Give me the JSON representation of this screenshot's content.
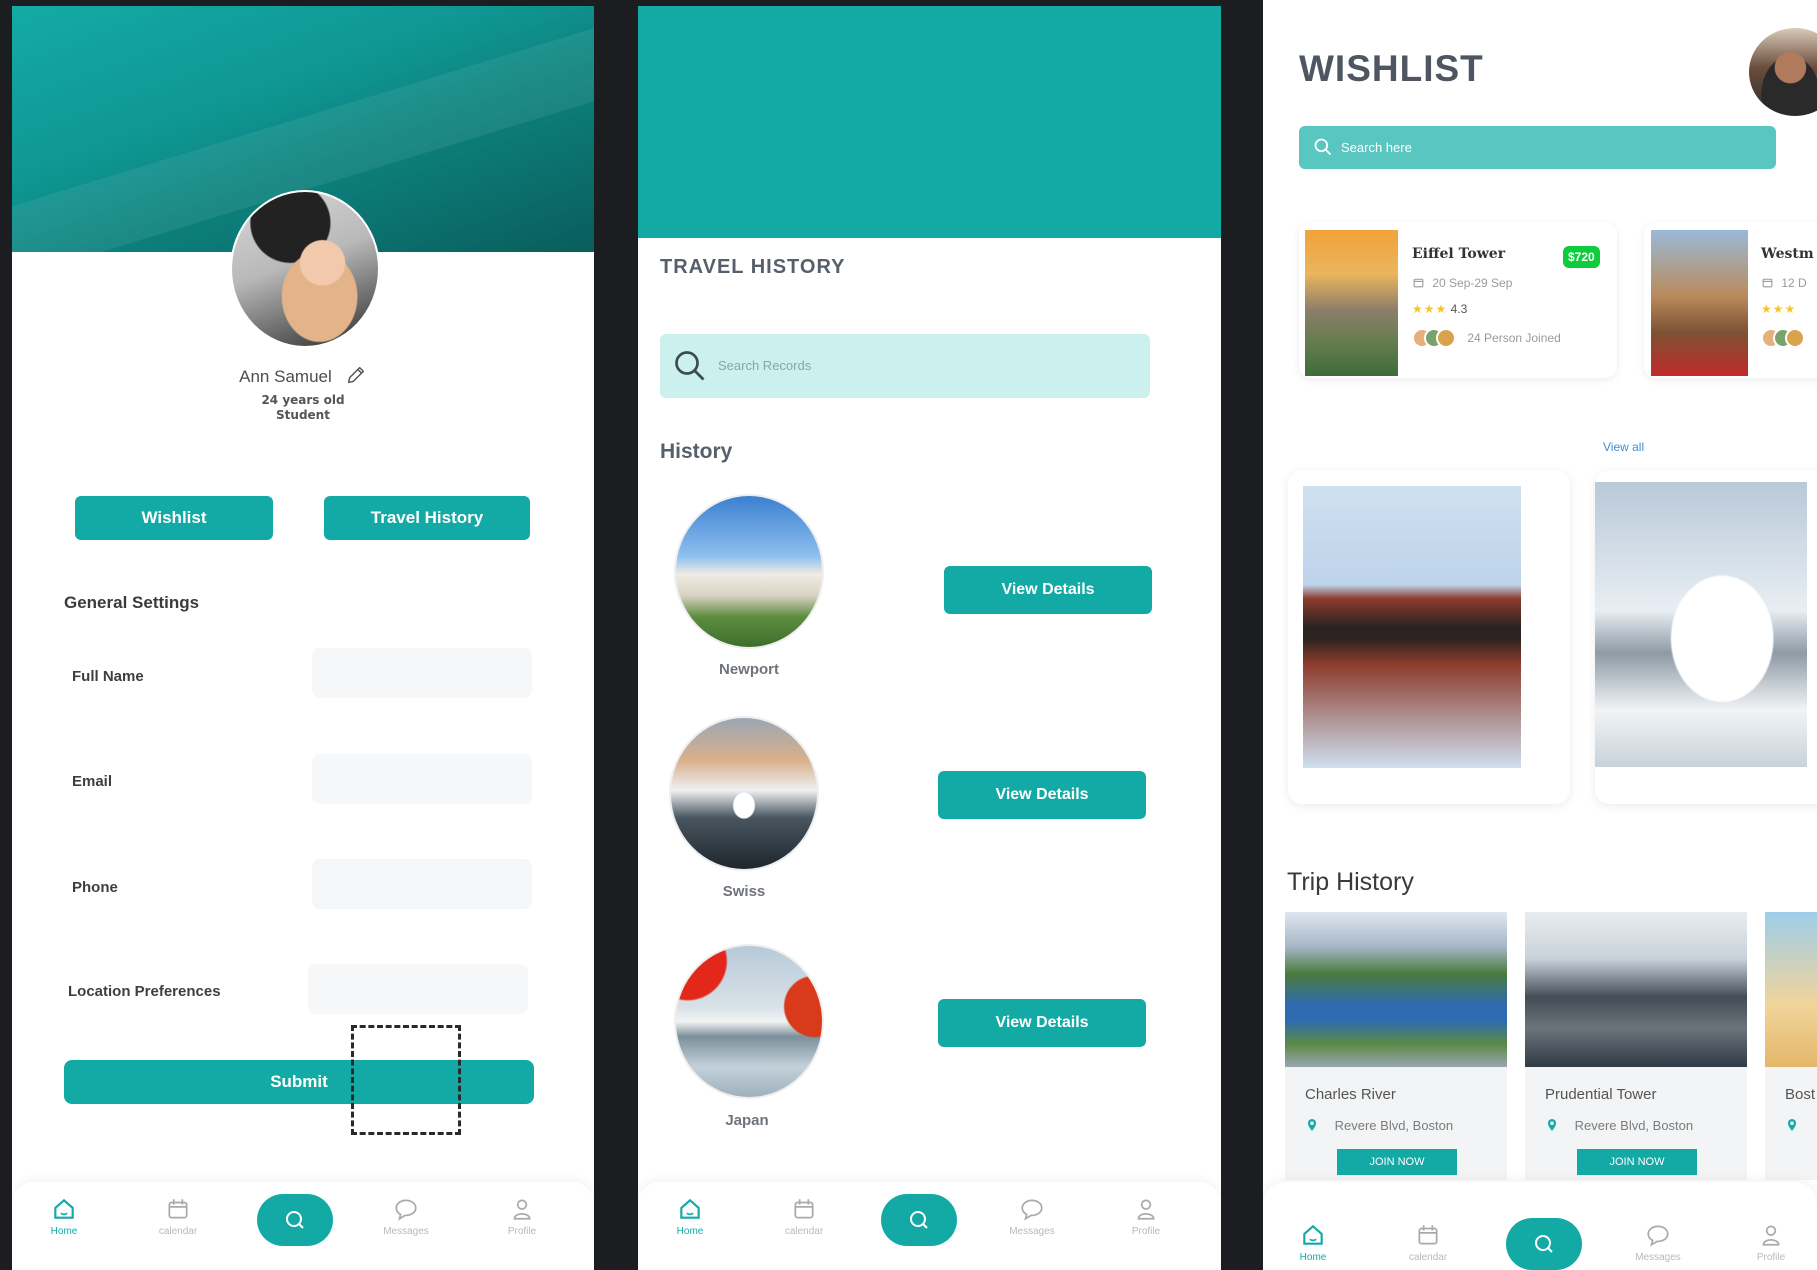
{
  "profile": {
    "name": "Ann Samuel",
    "age": "24 years old",
    "role": "Student",
    "wishlist_button": "Wishlist",
    "travel_history_button": "Travel History",
    "settings_title": "General Settings",
    "fields": [
      {
        "label": "Full Name"
      },
      {
        "label": "Email"
      },
      {
        "label": "Phone"
      },
      {
        "label": "Location Preferences"
      }
    ],
    "submit_label": "Submit"
  },
  "travel_history": {
    "title": "TRAVEL HISTORY",
    "search_placeholder": "Search Records",
    "section_title": "History",
    "items": [
      {
        "name": "Newport",
        "button": "View Details"
      },
      {
        "name": "Swiss",
        "button": "View Details"
      },
      {
        "name": "Japan",
        "button": "View Details"
      }
    ]
  },
  "wishlist": {
    "title": "WISHLIST",
    "search_placeholder": "Search here",
    "cards": [
      {
        "name": "Eiffel Tower",
        "price": "$720",
        "date": "20 Sep-29 Sep",
        "rating": "4.3",
        "stars": "★★★",
        "people": "24 Person Joined"
      },
      {
        "name": "Westm",
        "date": "12 D",
        "stars": "★★★"
      }
    ],
    "view_all": "View all",
    "trip_title": "Trip History",
    "trips": [
      {
        "name": "Charles River",
        "location": "Revere Blvd, Boston",
        "button": "JOIN NOW"
      },
      {
        "name": "Prudential Tower",
        "location": "Revere Blvd, Boston",
        "button": "JOIN NOW"
      },
      {
        "name": "Bost"
      }
    ]
  },
  "nav": {
    "home": "Home",
    "calendar": "calendar",
    "messages": "Messages",
    "profile": "Profile"
  },
  "colors": {
    "accent": "#13aaa6",
    "price_badge": "#0ecc3c",
    "link": "#3f8fd6"
  }
}
